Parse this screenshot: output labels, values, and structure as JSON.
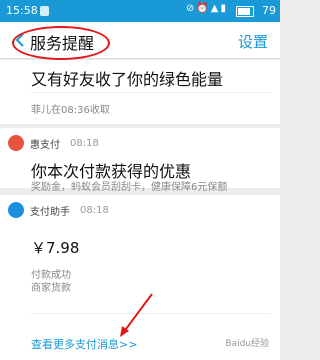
{
  "status_bar": {
    "time": "15:58",
    "battery_level": "79",
    "icons": [
      "mute-icon",
      "alarm-icon",
      "wifi-icon",
      "signal-icon"
    ]
  },
  "nav": {
    "title": "服务提醒",
    "settings_label": "设置"
  },
  "cards": [
    {
      "headline": "又有好友收了你的绿色能量",
      "detail": "菲儿在08:36收取"
    },
    {
      "app_name": "惠支付",
      "time": "08:18",
      "headline": "你本次付款获得的优惠",
      "detail": "奖励金，蚂蚁会员刮刮卡，健康保障6元保额"
    },
    {
      "app_name": "支付助手",
      "time": "08:18",
      "amount": "￥7.98",
      "status": "付款成功",
      "merchant": "商家货款",
      "more_link": "查看更多支付消息>>"
    }
  ],
  "watermark": "Baidu经验",
  "colors": {
    "accent": "#199ad6",
    "annotation": "#e01818",
    "hui_icon": "#e8533f",
    "zhifu_icon": "#1a8fe0"
  }
}
